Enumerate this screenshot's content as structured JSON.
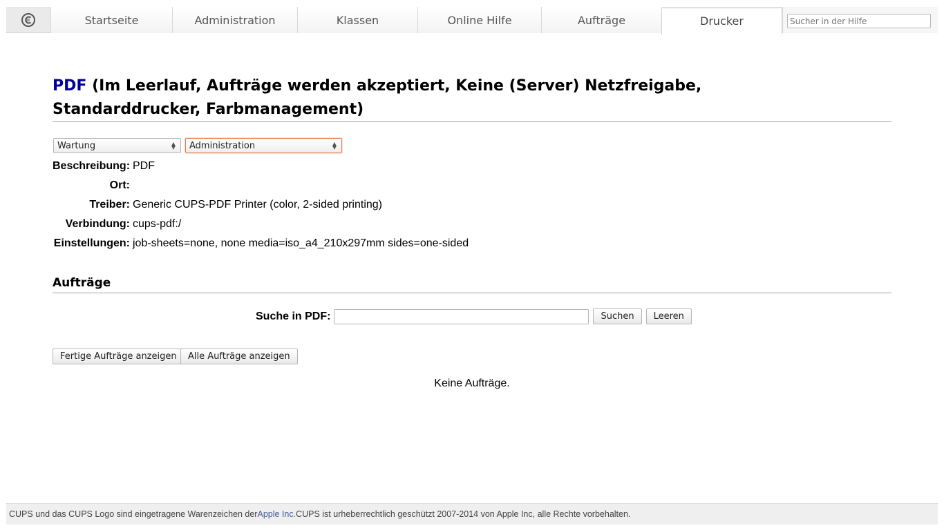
{
  "nav": {
    "logo_icon": "cups-logo-icon",
    "tabs": [
      {
        "label": "Startseite"
      },
      {
        "label": "Administration"
      },
      {
        "label": "Klassen"
      },
      {
        "label": "Online Hilfe"
      },
      {
        "label": "Aufträge"
      },
      {
        "label": "Drucker",
        "active": true
      }
    ],
    "search_placeholder": "Sucher in der Hilfe"
  },
  "printer": {
    "name": "PDF",
    "status": "(Im Leerlauf, Aufträge werden akzeptiert, Keine (Server) Netzfreigabe, Standarddrucker, Farbmanagement)",
    "maintenance_select": "Wartung",
    "admin_select": "Administration",
    "details": [
      {
        "label": "Beschreibung:",
        "value": "PDF"
      },
      {
        "label": "Ort:",
        "value": ""
      },
      {
        "label": "Treiber:",
        "value": "Generic CUPS-PDF Printer (color, 2-sided printing)"
      },
      {
        "label": "Verbindung:",
        "value": "cups-pdf:/"
      },
      {
        "label": "Einstellungen:",
        "value": "job-sheets=none, none media=iso_a4_210x297mm sides=one-sided"
      }
    ]
  },
  "jobs": {
    "section_title": "Aufträge",
    "search_label": "Suche in PDF:",
    "search_value": "",
    "search_button": "Suchen",
    "clear_button": "Leeren",
    "show_completed_button": "Fertige Aufträge anzeigen",
    "show_all_button": "Alle Aufträge anzeigen",
    "empty_message": "Keine Aufträge."
  },
  "footer": {
    "text_before": "CUPS und das CUPS Logo sind eingetragene Warenzeichen der ",
    "link": "Apple Inc.",
    "text_after": " CUPS ist urheberrechtlich geschützt 2007-2014 von Apple Inc, alle Rechte vorbehalten."
  },
  "colors": {
    "accent_link": "#000099",
    "focus_border": "#f07746"
  }
}
